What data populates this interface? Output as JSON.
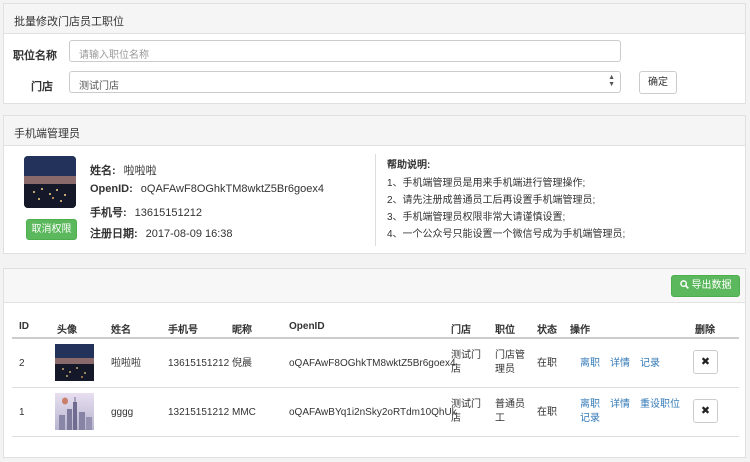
{
  "batch_panel": {
    "title": "批量修改门店员工职位",
    "position_label": "职位名称",
    "position_placeholder": "请输入职位名称",
    "store_label": "门店",
    "store_selected": "测试门店",
    "confirm_label": "确定"
  },
  "admin_panel": {
    "title": "手机端管理员",
    "name_label": "姓名:",
    "name_value": "啦啦啦",
    "openid_label": "OpenID:",
    "openid_value": "oQAFAwF8OGhkTM8wktZ5Br6goex4",
    "phone_label": "手机号:",
    "phone_value": "13615151212",
    "reg_label": "注册日期:",
    "reg_value": "2017-08-09 16:38",
    "revoke_label": "取消权限",
    "help_title": "帮助说明:",
    "help_lines": [
      "1、手机端管理员是用来手机端进行管理操作;",
      "2、请先注册成普通员工后再设置手机端管理员;",
      "3、手机端管理员权限非常大请谨慎设置;",
      "4、一个公众号只能设置一个微信号成为手机端管理员;"
    ]
  },
  "table_panel": {
    "export_label": "导出数据",
    "headers": {
      "id": "ID",
      "avatar": "头像",
      "name": "姓名",
      "phone": "手机号",
      "nickname": "昵称",
      "openid": "OpenID",
      "store": "门店",
      "position": "职位",
      "status": "状态",
      "actions": "操作",
      "delete": "删除"
    },
    "rows": [
      {
        "id": "2",
        "name": "啦啦啦",
        "phone": "13615151212",
        "nickname": "倪晨",
        "openid": "oQAFAwF8OGhkTM8wktZ5Br6goex4",
        "store_l1": "测试门",
        "store_l2": "店",
        "position_l1": "门店管",
        "position_l2": "理员",
        "status": "在职",
        "action_resign": "离职",
        "action_detail": "详情",
        "action_record": "记录",
        "delete_symbol": "✖"
      },
      {
        "id": "1",
        "name": "gggg",
        "phone": "13215151212",
        "nickname": "MMC",
        "openid": "oQAFAwBYq1i2nSky2oRTdm10QhUk",
        "store_l1": "测试门",
        "store_l2": "店",
        "position_l1": "普通员",
        "position_l2": "工",
        "status": "在职",
        "action_resign": "离职",
        "action_detail": "详情",
        "action_reset": "重设职位",
        "action_record": "记录",
        "delete_symbol": "✖"
      }
    ]
  },
  "colors": {
    "accent_green": "#5cb85c",
    "link_blue": "#337ab7"
  },
  "icons": {
    "select_arrow": "▲▼",
    "export_icon": "search-icon"
  }
}
